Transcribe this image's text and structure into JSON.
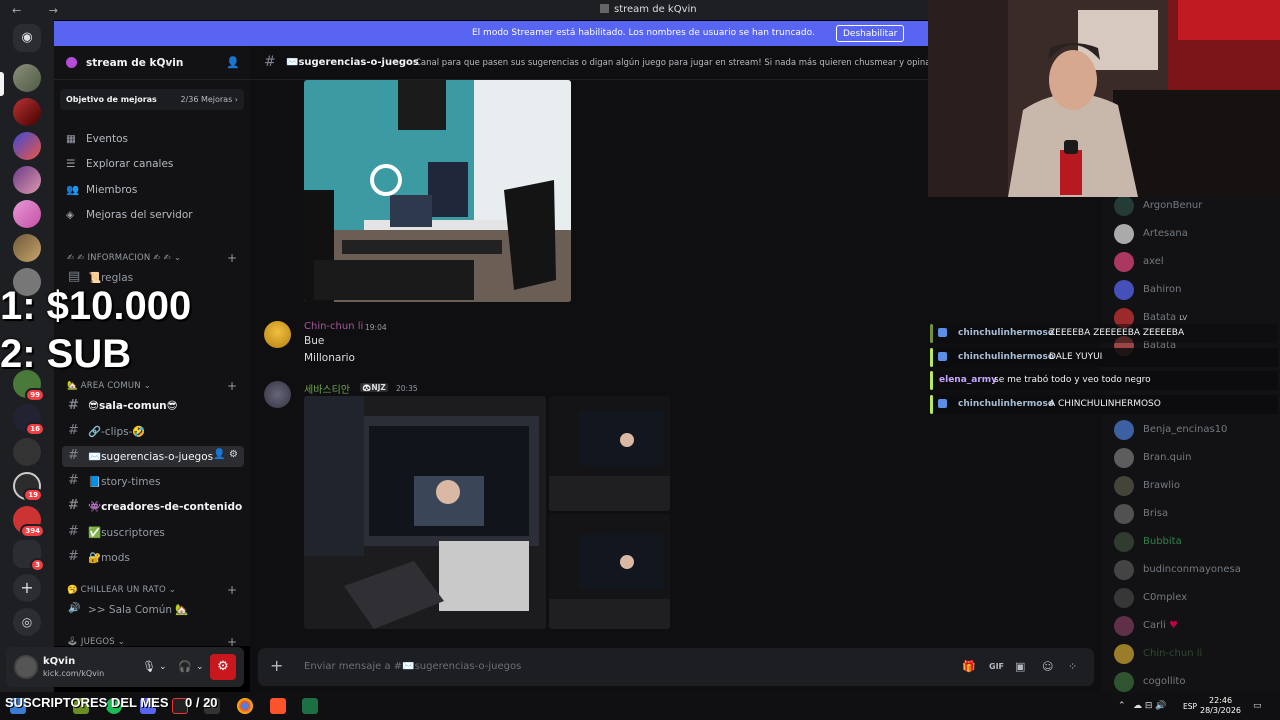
{
  "window": {
    "title": "stream de kQvin"
  },
  "streamer_banner": {
    "text": "El modo Streamer está habilitado. Los nombres de usuario se han truncado.",
    "button": "Deshabilitar"
  },
  "server": {
    "name": "stream de kQvin",
    "goal_label": "Objetivo de mejoras",
    "goal_progress": "2/36 Mejoras",
    "nav": [
      {
        "icon": "calendar-icon",
        "label": "Eventos"
      },
      {
        "icon": "browse-icon",
        "label": "Explorar canales"
      },
      {
        "icon": "members-icon",
        "label": "Miembros"
      },
      {
        "icon": "boost-icon",
        "label": "Mejoras del servidor"
      }
    ],
    "categories": {
      "info": "✍ ✍ INFORMACION ✍ ✍",
      "area": "🏡 AREA COMUN",
      "chill": "🥱 CHILLEAR UN RATO",
      "games": "🕹 JUEGOS"
    },
    "channels": [
      {
        "label": "📜reglas"
      },
      {
        "label": "😎sala-comun😎"
      },
      {
        "label": "🔗-clips-🤣"
      },
      {
        "label": "✉️sugerencias-o-juegos"
      },
      {
        "label": "📘story-times"
      },
      {
        "label": "👾creadores-de-contenido"
      },
      {
        "label": "✅suscriptores"
      },
      {
        "label": "🔐mods"
      }
    ],
    "voice_channel": ">> Sala Común 🏡"
  },
  "user_panel": {
    "name": "kQvin",
    "status": "kick.com/kQvin"
  },
  "channel_header": {
    "name": "✉️sugerencias-o-juegos",
    "topic": "Canal para que pasen sus sugerencias o digan algún juego para jugar en stream! Si nada más quieren chusmear y opinar puede"
  },
  "messages": [
    {
      "author": "Chin-chun li",
      "time": "19:04",
      "lines": [
        "Bue",
        "Millonario"
      ]
    },
    {
      "author": "세바스티안",
      "tag": "🐼NJZ",
      "time": "20:35"
    }
  ],
  "composer": {
    "placeholder": "Enviar mensaje a #✉️sugerencias-o-juegos"
  },
  "members": [
    "ArgonBenur",
    "Artesana",
    "axel",
    "Bahiron",
    "Batata",
    "Batata",
    "Benja_encinas10",
    "Bran.quin",
    "Brawlio",
    "Brisa",
    "Bubbita",
    "budinconmayonesa",
    "C0mplex",
    "Carli",
    "Chin-chun li",
    "cogollito"
  ],
  "member_badge": "LV",
  "stream_chat": [
    {
      "user": "chinchulinhermoso",
      "text": "ZEEEEBA ZEEEEEBA ZEEEEBA"
    },
    {
      "user": "chinchulinhermoso",
      "text": "DALE YUYUI"
    },
    {
      "user": "elena_army",
      "text": "se me trabó todo y veo todo negro"
    },
    {
      "user": "chinchulinhermoso",
      "text": "A CHINCHULINHERMOSO"
    }
  ],
  "overlay": {
    "line1": "1: $10.000",
    "line2": "2: SUB",
    "subs_label": "SUSCRIPTORES DEL MES",
    "subs_count": "0 / 20"
  },
  "guild_badges": [
    "99",
    "16",
    "19",
    "394",
    "3"
  ],
  "taskbar": {
    "lang": "ESP",
    "time": "22:46",
    "date": "28/3/2026"
  },
  "colors": {
    "accent": "#5865f2",
    "danger": "#c8181d",
    "chat_bar": "#b9e85c"
  }
}
